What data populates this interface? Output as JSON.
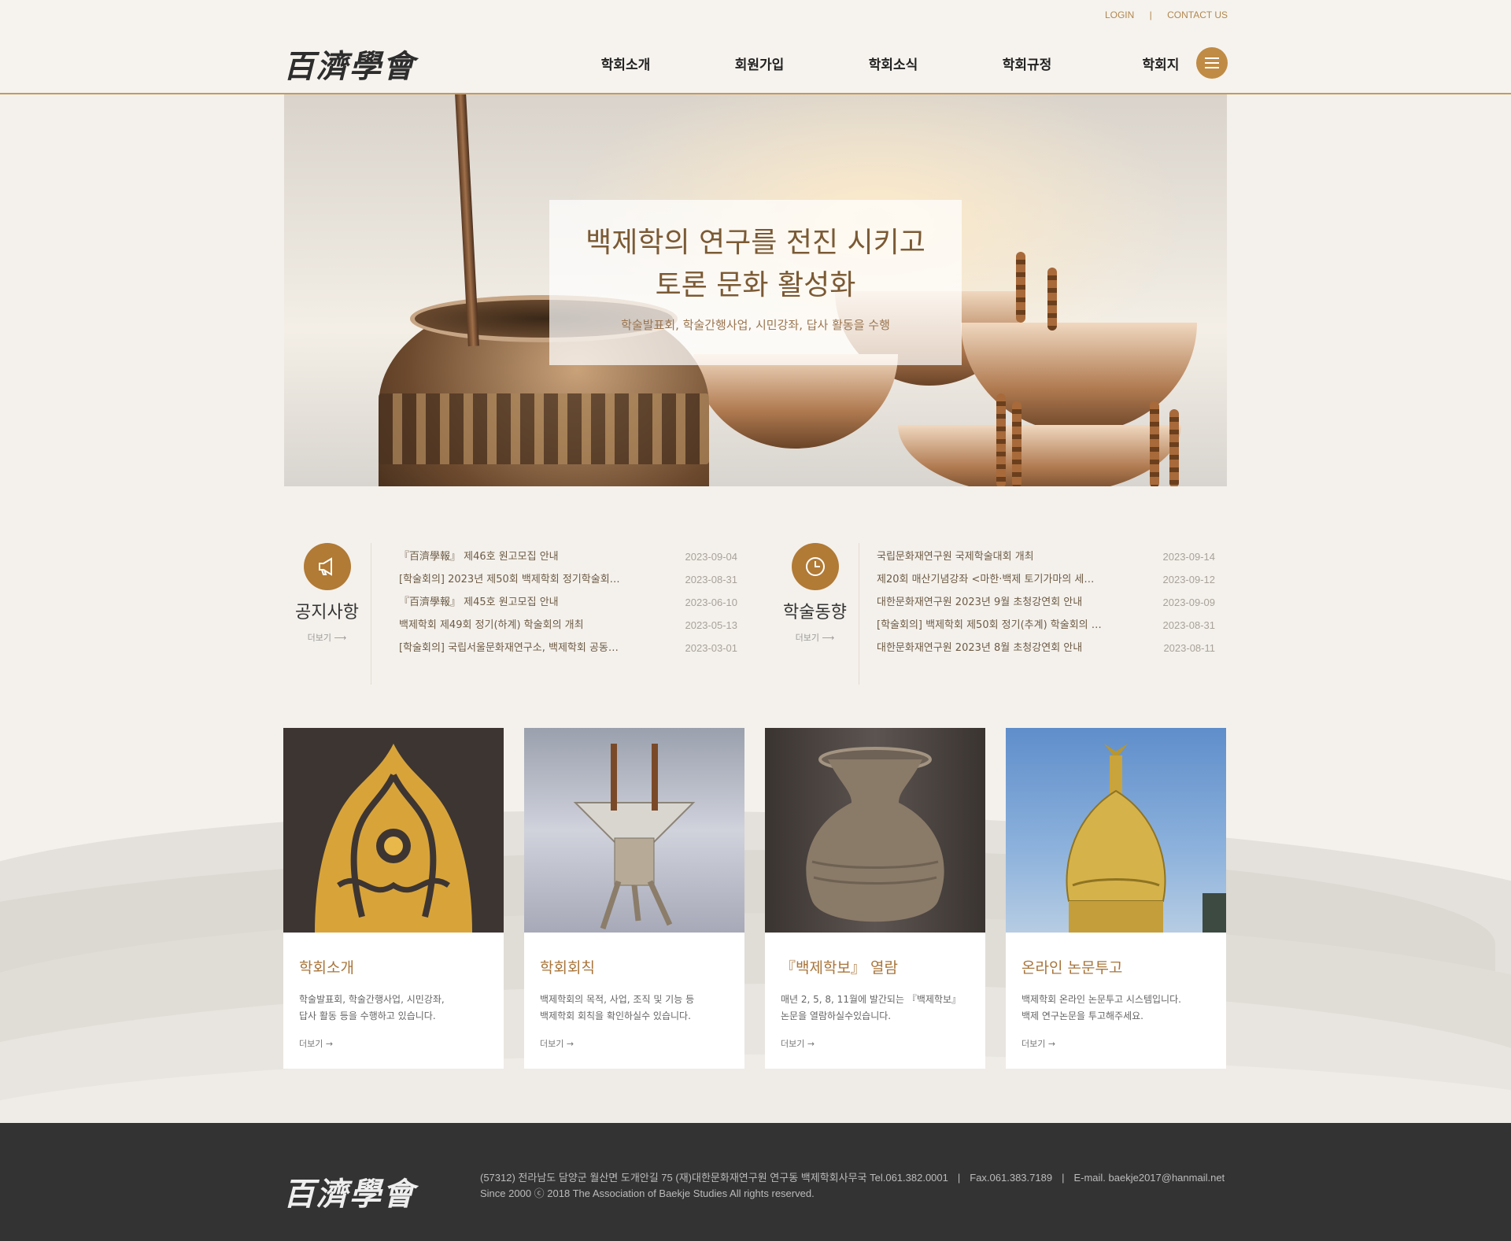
{
  "util": {
    "login": "LOGIN",
    "contact": "CONTACT US"
  },
  "logo": "百濟學會",
  "nav": [
    "학회소개",
    "회원가입",
    "학회소식",
    "학회규정",
    "학회지"
  ],
  "hero": {
    "title_line1": "백제학의 연구를 전진 시키고",
    "title_line2": "토론 문화 활성화",
    "subtitle": "학술발표회, 학술간행사업, 시민강좌, 답사 활동을 수행"
  },
  "notice": {
    "title": "공지사항",
    "more": "더보기 ⟶",
    "items": [
      {
        "title": "『百濟學報』 제46호 원고모집 안내",
        "date": "2023-09-04"
      },
      {
        "title": "[학술회의] 2023년 제50회 백제학회 정기학술회…",
        "date": "2023-08-31"
      },
      {
        "title": "『百濟學報』 제45호 원고모집 안내",
        "date": "2023-06-10"
      },
      {
        "title": "백제학회 제49회 정기(하계) 학술회의 개최",
        "date": "2023-05-13"
      },
      {
        "title": "[학술회의] 국립서울문화재연구소, 백제학회 공동…",
        "date": "2023-03-01"
      }
    ]
  },
  "trend": {
    "title": "학술동향",
    "more": "더보기 ⟶",
    "items": [
      {
        "title": "국립문화재연구원 국제학술대회 개최",
        "date": "2023-09-14"
      },
      {
        "title": "제20회 매산기념강좌 <마한·백제 토기가마의 세…",
        "date": "2023-09-12"
      },
      {
        "title": "대한문화재연구원 2023년 9월 초청강연회 안내",
        "date": "2023-09-09"
      },
      {
        "title": "[학술회의] 백제학회 제50회 정기(추계) 학술회의 …",
        "date": "2023-08-31"
      },
      {
        "title": "대한문화재연구원 2023년 8월 초청강연회 안내",
        "date": "2023-08-11"
      }
    ]
  },
  "cards": [
    {
      "title": "학회소개",
      "desc1": "학술발표회, 학술간행사업, 시민강좌,",
      "desc2": "답사 활동 등을 수행하고 있습니다.",
      "more": "더보기 →"
    },
    {
      "title": "학회회칙",
      "desc1": "백제학회의 목적, 사업, 조직 및 기능 등",
      "desc2": "백제학회 회칙을 확인하실수 있습니다.",
      "more": "더보기 →"
    },
    {
      "title": "『백제학보』 열람",
      "desc1": "매년 2, 5, 8, 11월에 발간되는 『백제학보』",
      "desc2": "논문을 열람하실수있습니다.",
      "more": "더보기 →"
    },
    {
      "title": "온라인 논문투고",
      "desc1": "백제학회 온라인 논문투고 시스템입니다.",
      "desc2": "백제 연구논문을 투고해주세요.",
      "more": "더보기 →"
    }
  ],
  "footer": {
    "logo": "百濟學會",
    "address": "(57312) 전라남도 담양군 월산면 도개안길 75 (재)대한문화재연구원 연구동 백제학회사무국 Tel.061.382.0001",
    "fax": "Fax.061.383.7189",
    "email": "E-mail. baekje2017@hanmail.net",
    "copyright": "Since 2000 ⓒ 2018 The Association of Baekje Studies All rights reserved."
  },
  "colors": {
    "accent": "#b17a35",
    "footer_bg": "#333333"
  },
  "icons": {
    "notice": "megaphone-icon",
    "trend": "clock-icon",
    "menu": "hamburger-icon"
  }
}
